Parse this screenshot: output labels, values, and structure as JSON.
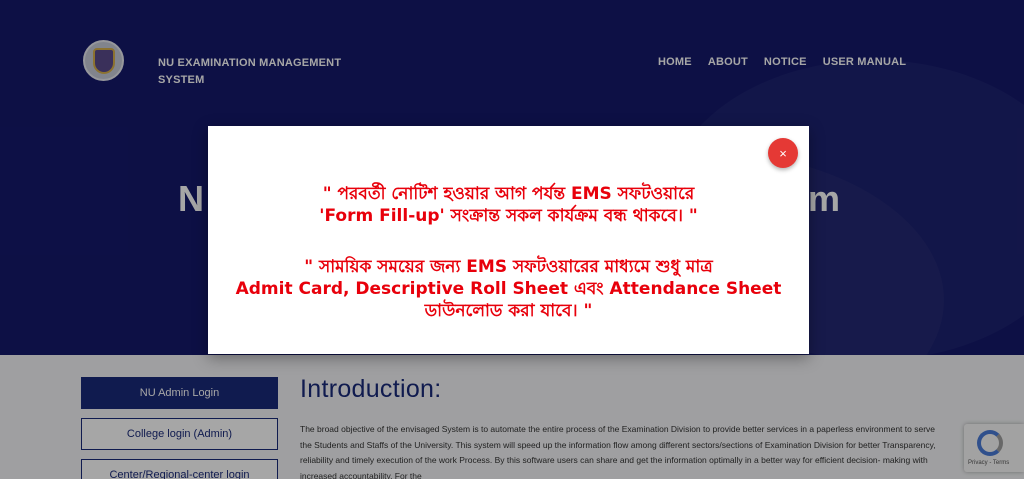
{
  "header": {
    "brand_line1": "NU EXAMINATION MANAGEMENT",
    "brand_line2": "SYSTEM",
    "nav": [
      "HOME",
      "ABOUT",
      "NOTICE",
      "USER MANUAL"
    ]
  },
  "hero": {
    "title_left": "N",
    "title_right": "m"
  },
  "sidebar": {
    "buttons": [
      "NU Admin Login",
      "College login (Admin)",
      "Center/Regional-center login"
    ]
  },
  "intro": {
    "heading": "Introduction:",
    "body": "The broad objective of the envisaged System is to automate the entire process of the Examination Division to provide better services in a paperless environment to serve the Students and Staffs of the University. This system will speed up the information flow among different sectors/sections of Examination Division for better Transparency, reliability and timely execution of the work Process. By this software users can share and get the information optimally in a better way for efficient decision- making with increased accountability. For the"
  },
  "modal": {
    "close_glyph": "×",
    "msg1_line1": "\" পরবর্তী নোটিশ হওয়ার আগ পর্যন্ত EMS সফটওয়ারে",
    "msg1_line2": "'Form Fill-up' সংক্রান্ত সকল কার্যক্রম বন্ধ থাকবে। \"",
    "msg2_line1": "\" সাময়িক সময়ের জন্য EMS সফটওয়ারের মাধ্যমে শুধু মাত্র",
    "msg2_line2": "Admit Card, Descriptive Roll Sheet এবং Attendance Sheet",
    "msg2_line3": "ডাউনলোড করা যাবে। \""
  },
  "recaptcha": {
    "text": "Privacy - Terms"
  },
  "colors": {
    "hero_bg": "#14196b",
    "primary": "#1a2a7a",
    "alert_red": "#e8000b",
    "close_red": "#e53935"
  }
}
